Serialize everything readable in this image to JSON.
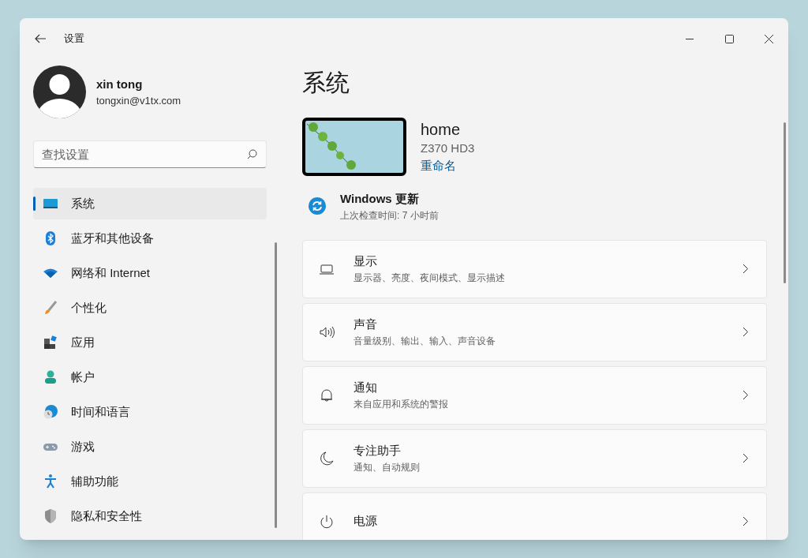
{
  "window": {
    "title": "设置"
  },
  "account": {
    "name": "xin tong",
    "email": "tongxin@v1tx.com"
  },
  "search": {
    "placeholder": "查找设置"
  },
  "sidebar": {
    "items": [
      {
        "label": "系统",
        "selected": true
      },
      {
        "label": "蓝牙和其他设备",
        "selected": false
      },
      {
        "label": "网络和 Internet",
        "selected": false
      },
      {
        "label": "个性化",
        "selected": false
      },
      {
        "label": "应用",
        "selected": false
      },
      {
        "label": "帐户",
        "selected": false
      },
      {
        "label": "时间和语言",
        "selected": false
      },
      {
        "label": "游戏",
        "selected": false
      },
      {
        "label": "辅助功能",
        "selected": false
      },
      {
        "label": "隐私和安全性",
        "selected": false
      }
    ]
  },
  "page": {
    "title": "系统"
  },
  "device": {
    "name": "home",
    "model": "Z370 HD3",
    "rename_link": "重命名"
  },
  "update": {
    "title": "Windows 更新",
    "subtitle": "上次检查时间: 7 小时前"
  },
  "cards": [
    {
      "title": "显示",
      "subtitle": "显示器、亮度、夜间模式、显示描述"
    },
    {
      "title": "声音",
      "subtitle": "音量级别、输出、输入、声音设备"
    },
    {
      "title": "通知",
      "subtitle": "来自应用和系统的警报"
    },
    {
      "title": "专注助手",
      "subtitle": "通知、自动规则"
    },
    {
      "title": "电源"
    }
  ]
}
